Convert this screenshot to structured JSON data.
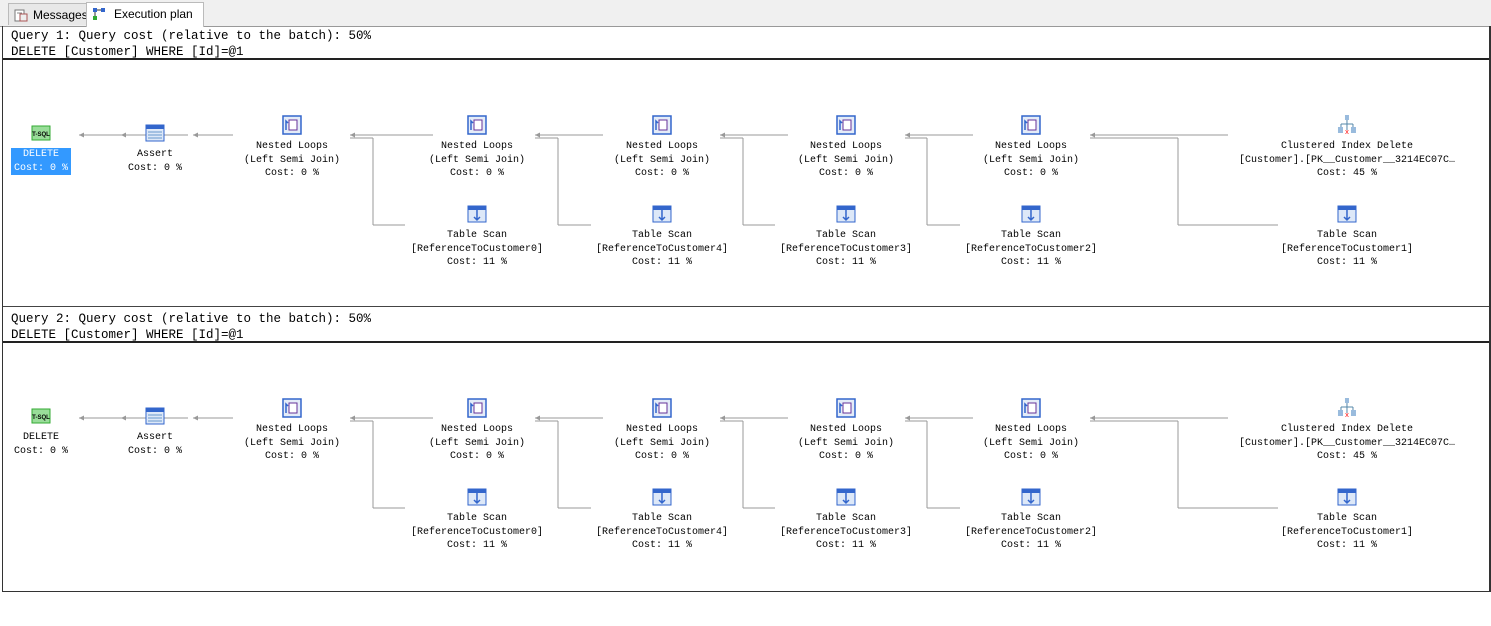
{
  "tabs": [
    {
      "label": "Messages",
      "icon": "messages-icon"
    },
    {
      "label": "Execution plan",
      "icon": "execution-plan-icon",
      "active": true
    }
  ],
  "queries": [
    {
      "header": "Query 1: Query cost (relative to the batch): 50%",
      "sql": "DELETE [Customer] WHERE [Id]=@1",
      "selected_node": "DELETE",
      "nodes": [
        {
          "icon": "tsql-icon",
          "lines": [
            "DELETE",
            "Cost: 0 %"
          ]
        },
        {
          "icon": "assert-icon",
          "lines": [
            "Assert",
            "Cost: 0 %"
          ]
        },
        {
          "icon": "nested-loops-icon",
          "lines": [
            "Nested Loops",
            "(Left Semi Join)",
            "Cost: 0 %"
          ]
        },
        {
          "icon": "nested-loops-icon",
          "lines": [
            "Nested Loops",
            "(Left Semi Join)",
            "Cost: 0 %"
          ]
        },
        {
          "icon": "nested-loops-icon",
          "lines": [
            "Nested Loops",
            "(Left Semi Join)",
            "Cost: 0 %"
          ]
        },
        {
          "icon": "nested-loops-icon",
          "lines": [
            "Nested Loops",
            "(Left Semi Join)",
            "Cost: 0 %"
          ]
        },
        {
          "icon": "nested-loops-icon",
          "lines": [
            "Nested Loops",
            "(Left Semi Join)",
            "Cost: 0 %"
          ]
        },
        {
          "icon": "clustered-index-delete-icon",
          "lines": [
            "Clustered Index Delete",
            "[Customer].[PK__Customer__3214EC07C…",
            "Cost: 45 %"
          ]
        },
        {
          "icon": "table-scan-icon",
          "lines": [
            "Table Scan",
            "[ReferenceToCustomer0]",
            "Cost: 11 %"
          ]
        },
        {
          "icon": "table-scan-icon",
          "lines": [
            "Table Scan",
            "[ReferenceToCustomer4]",
            "Cost: 11 %"
          ]
        },
        {
          "icon": "table-scan-icon",
          "lines": [
            "Table Scan",
            "[ReferenceToCustomer3]",
            "Cost: 11 %"
          ]
        },
        {
          "icon": "table-scan-icon",
          "lines": [
            "Table Scan",
            "[ReferenceToCustomer2]",
            "Cost: 11 %"
          ]
        },
        {
          "icon": "table-scan-icon",
          "lines": [
            "Table Scan",
            "[ReferenceToCustomer1]",
            "Cost: 11 %"
          ]
        }
      ]
    },
    {
      "header": "Query 2: Query cost (relative to the batch): 50%",
      "sql": "DELETE [Customer] WHERE [Id]=@1",
      "selected_node": "",
      "nodes": [
        {
          "icon": "tsql-icon",
          "lines": [
            "DELETE",
            "Cost: 0 %"
          ]
        },
        {
          "icon": "assert-icon",
          "lines": [
            "Assert",
            "Cost: 0 %"
          ]
        },
        {
          "icon": "nested-loops-icon",
          "lines": [
            "Nested Loops",
            "(Left Semi Join)",
            "Cost: 0 %"
          ]
        },
        {
          "icon": "nested-loops-icon",
          "lines": [
            "Nested Loops",
            "(Left Semi Join)",
            "Cost: 0 %"
          ]
        },
        {
          "icon": "nested-loops-icon",
          "lines": [
            "Nested Loops",
            "(Left Semi Join)",
            "Cost: 0 %"
          ]
        },
        {
          "icon": "nested-loops-icon",
          "lines": [
            "Nested Loops",
            "(Left Semi Join)",
            "Cost: 0 %"
          ]
        },
        {
          "icon": "nested-loops-icon",
          "lines": [
            "Nested Loops",
            "(Left Semi Join)",
            "Cost: 0 %"
          ]
        },
        {
          "icon": "clustered-index-delete-icon",
          "lines": [
            "Clustered Index Delete",
            "[Customer].[PK__Customer__3214EC07C…",
            "Cost: 45 %"
          ]
        },
        {
          "icon": "table-scan-icon",
          "lines": [
            "Table Scan",
            "[ReferenceToCustomer0]",
            "Cost: 11 %"
          ]
        },
        {
          "icon": "table-scan-icon",
          "lines": [
            "Table Scan",
            "[ReferenceToCustomer4]",
            "Cost: 11 %"
          ]
        },
        {
          "icon": "table-scan-icon",
          "lines": [
            "Table Scan",
            "[ReferenceToCustomer3]",
            "Cost: 11 %"
          ]
        },
        {
          "icon": "table-scan-icon",
          "lines": [
            "Table Scan",
            "[ReferenceToCustomer2]",
            "Cost: 11 %"
          ]
        },
        {
          "icon": "table-scan-icon",
          "lines": [
            "Table Scan",
            "[ReferenceToCustomer1]",
            "Cost: 11 %"
          ]
        }
      ]
    }
  ],
  "colors": {
    "selection": "#3399ff",
    "connector": "#999999"
  }
}
